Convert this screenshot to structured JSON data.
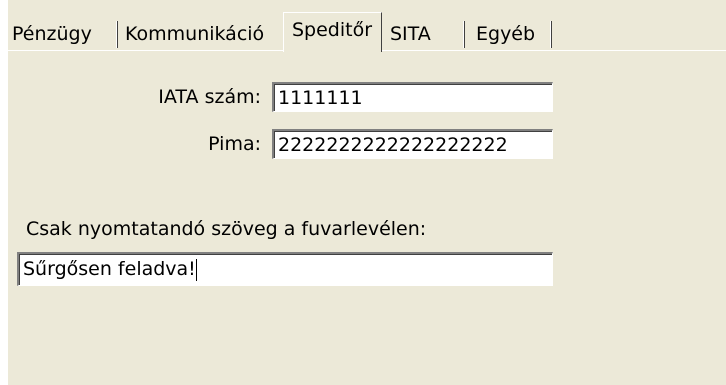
{
  "tabs": [
    {
      "label": "Pénzügy",
      "active": false
    },
    {
      "label": "Kommunikáció",
      "active": false
    },
    {
      "label": "Speditőr",
      "active": true
    },
    {
      "label": "SITA",
      "active": false
    },
    {
      "label": "Egyéb",
      "active": false
    }
  ],
  "form": {
    "iata_label": "IATA szám:",
    "iata_value": "1111111",
    "pima_label": "Pima:",
    "pima_value": "2222222222222222222",
    "print_text_label": "Csak nyomtatandó szöveg a fuvarlevélen:",
    "print_text_value": "Sűrgősen feladva!"
  },
  "colors": {
    "panel_background": "#ece9d8",
    "input_background": "#ffffff"
  }
}
